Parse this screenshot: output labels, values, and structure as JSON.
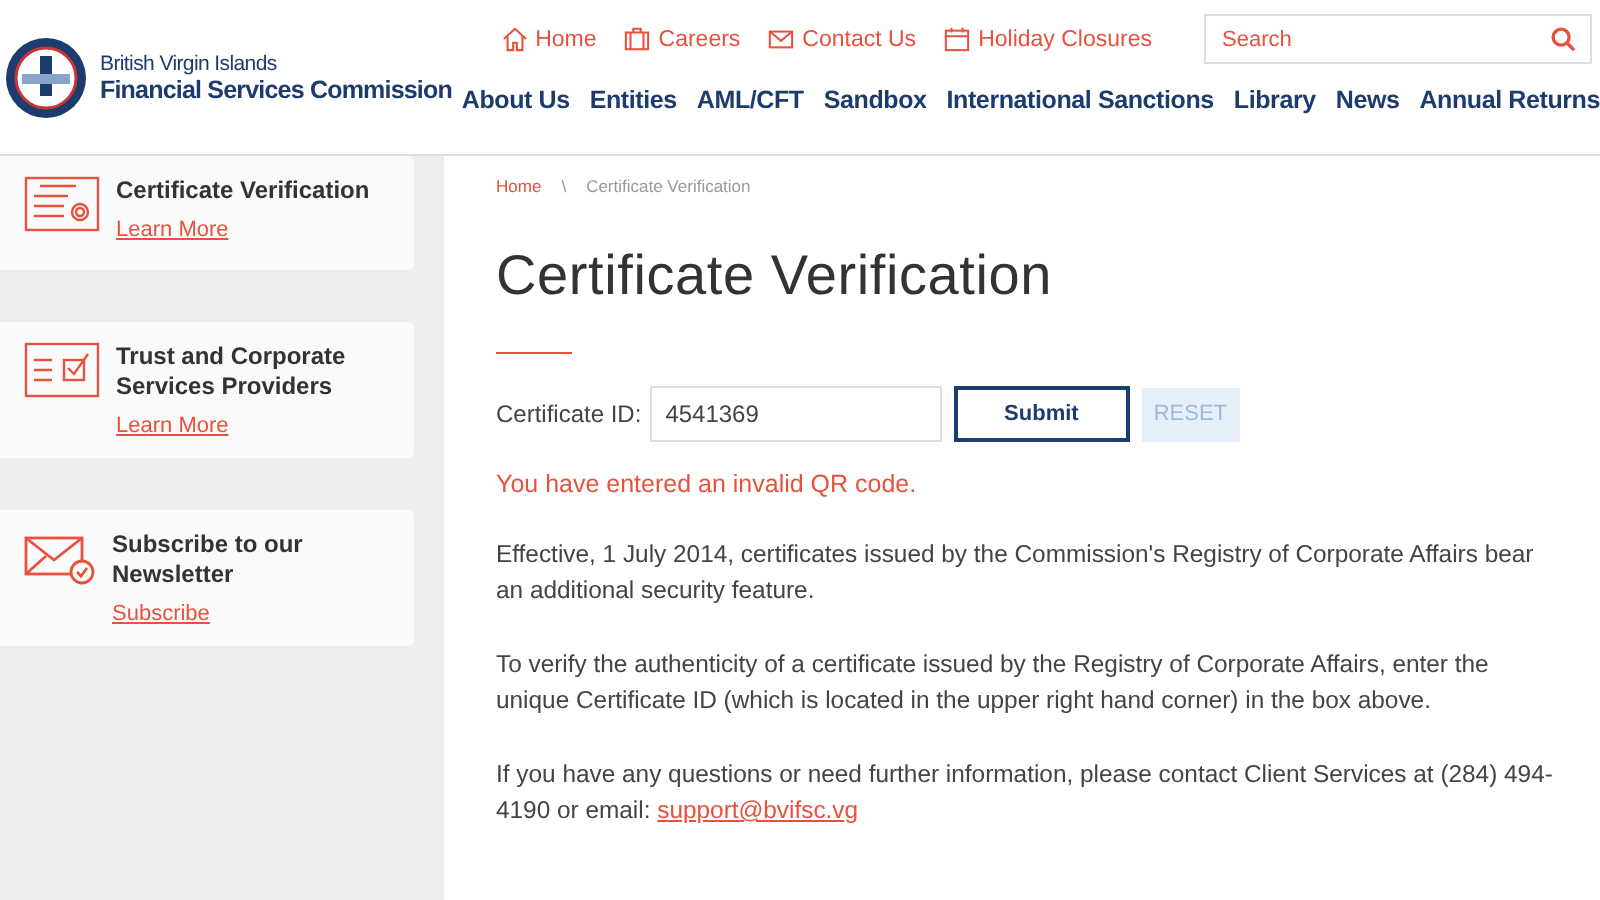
{
  "logo": {
    "line1": "British Virgin Islands",
    "line2": "Financial Services Commission"
  },
  "top_links": [
    {
      "kind": "home",
      "label": "Home"
    },
    {
      "kind": "careers",
      "label": "Careers"
    },
    {
      "kind": "contact",
      "label": "Contact Us"
    },
    {
      "kind": "calendar",
      "label": "Holiday Closures"
    }
  ],
  "search": {
    "placeholder": "Search"
  },
  "nav": [
    "About Us",
    "Entities",
    "AML/CFT",
    "Sandbox",
    "International Sanctions",
    "Library",
    "News",
    "Annual Returns"
  ],
  "sidebar": {
    "items": [
      {
        "kind": "certificate",
        "title": "Certificate Verification",
        "link": "Learn More"
      },
      {
        "kind": "checklist",
        "title": "Trust and Corporate Services Providers",
        "link": "Learn More"
      },
      {
        "kind": "envelope",
        "title": "Subscribe to our Newsletter",
        "link": "Subscribe"
      }
    ]
  },
  "breadcrumb": [
    {
      "label": "Home",
      "selected": false
    },
    {
      "label": "Certificate Verification",
      "selected": true
    }
  ],
  "breadcrumb_separator": "\\",
  "title": "Certificate Verification",
  "form": {
    "label": "Certificate ID:",
    "value": "4541369",
    "submit": "Submit",
    "reset": {
      "label": "RESET",
      "disabled": true
    }
  },
  "error": "You have entered an invalid QR code.",
  "paragraphs": [
    [
      {
        "kind": "text",
        "text": "Effective, 1 July 2014, certificates issued by the Commission's Registry of Corporate Affairs bear an additional security feature."
      }
    ],
    [
      {
        "kind": "text",
        "text": "To verify the authenticity of a certificate issued by the Registry of Corporate Affairs, enter the unique Certificate ID (which is located in the upper right hand corner) in the box above."
      }
    ],
    [
      {
        "kind": "text",
        "text": "If you have any questions or need further information, please contact Client Services at (284) 494-4190 or email: "
      },
      {
        "kind": "link",
        "text": "support@bvifsc.vg"
      }
    ]
  ]
}
